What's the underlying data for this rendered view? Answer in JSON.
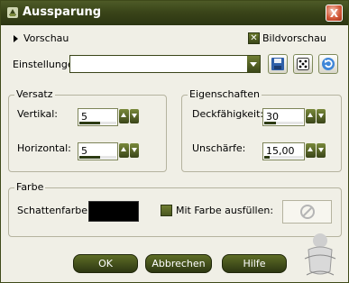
{
  "window": {
    "title": "Aussparung",
    "close_label": "X"
  },
  "preview": {
    "vorschau_label": "Vorschau",
    "bildvorschau_label": "Bildvorschau",
    "bildvorschau_checked": true
  },
  "settings": {
    "label": "Einstellungen",
    "value": ""
  },
  "versatz": {
    "title": "Versatz",
    "vertikal_label": "Vertikal:",
    "vertikal_value": "5",
    "vertikal_level": 0.55,
    "horizontal_label": "Horizontal:",
    "horizontal_value": "5",
    "horizontal_level": 0.55
  },
  "eigenschaften": {
    "title": "Eigenschaften",
    "deckfaehigkeit_label": "Deckfähigkeit:",
    "deckfaehigkeit_value": "30",
    "deckfaehigkeit_level": 0.3,
    "unschaerfe_label": "Unschärfe:",
    "unschaerfe_value": "15,00",
    "unschaerfe_level": 0.15
  },
  "farbe": {
    "title": "Farbe",
    "schattenfarbe_label": "Schattenfarbe:",
    "schattenfarbe_color": "#000000",
    "mit_farbe_label": "Mit Farbe ausfüllen:",
    "mit_farbe_checked": false
  },
  "buttons": {
    "ok": "OK",
    "abbrechen": "Abbrechen",
    "hilfe": "Hilfe"
  },
  "colors": {
    "accent": "#3a4519",
    "background": "#f0efe6"
  }
}
